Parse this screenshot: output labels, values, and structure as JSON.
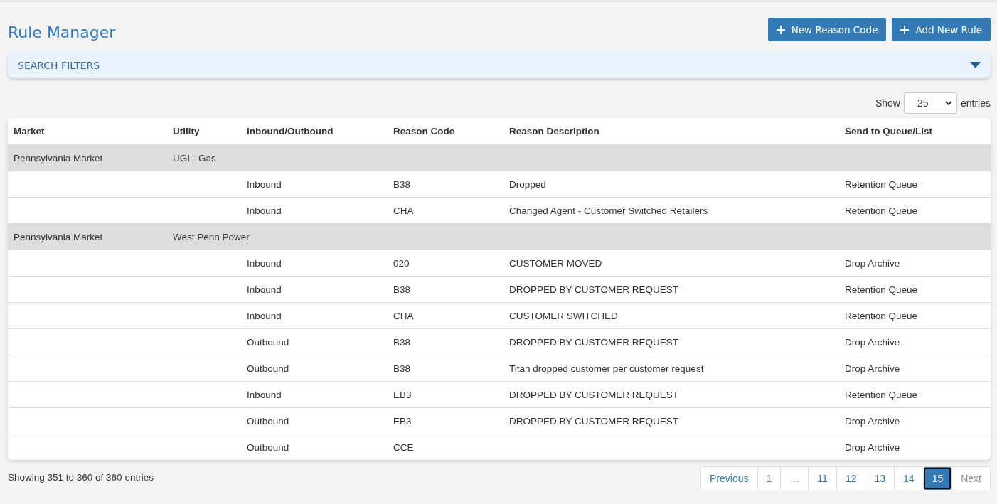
{
  "title": "Rule Manager",
  "actions": [
    "New Reason Code",
    "Add New Rule"
  ],
  "search_filters": {
    "label": "SEARCH FILTERS",
    "expanded": false
  },
  "length": {
    "before": "Show",
    "value": "25",
    "after": "entries"
  },
  "table": {
    "columns": [
      "Market",
      "Utility",
      "Inbound/Outbound",
      "Reason Code",
      "Reason Description",
      "Send to Queue/List"
    ],
    "rows": [
      {
        "kind": "group",
        "cells": [
          "Pennsylvania Market",
          "UGI - Gas"
        ]
      },
      {
        "kind": "rule",
        "cells": [
          "",
          "",
          "Inbound",
          "B38",
          "Dropped",
          "Retention Queue"
        ]
      },
      {
        "kind": "rule",
        "cells": [
          "",
          "",
          "Inbound",
          "CHA",
          "Changed Agent - Customer Switched Retailers",
          "Retention Queue"
        ]
      },
      {
        "kind": "group",
        "cells": [
          "Pennsylvania Market",
          "West Penn Power"
        ]
      },
      {
        "kind": "rule",
        "cells": [
          "",
          "",
          "Inbound",
          "020",
          "CUSTOMER MOVED",
          "Drop Archive"
        ]
      },
      {
        "kind": "rule",
        "cells": [
          "",
          "",
          "Inbound",
          "B38",
          "DROPPED BY CUSTOMER REQUEST",
          "Retention Queue"
        ]
      },
      {
        "kind": "rule",
        "cells": [
          "",
          "",
          "Inbound",
          "CHA",
          "CUSTOMER SWITCHED",
          "Retention Queue"
        ]
      },
      {
        "kind": "rule",
        "cells": [
          "",
          "",
          "Outbound",
          "B38",
          "DROPPED BY CUSTOMER REQUEST",
          "Drop Archive"
        ]
      },
      {
        "kind": "rule",
        "cells": [
          "",
          "",
          "Outbound",
          "B38",
          "Titan dropped customer per customer request",
          "Drop Archive"
        ]
      },
      {
        "kind": "rule",
        "cells": [
          "",
          "",
          "Inbound",
          "EB3",
          "DROPPED BY CUSTOMER REQUEST",
          "Retention Queue"
        ]
      },
      {
        "kind": "rule",
        "cells": [
          "",
          "",
          "Outbound",
          "EB3",
          "DROPPED BY CUSTOMER REQUEST",
          "Drop Archive"
        ]
      },
      {
        "kind": "rule",
        "cells": [
          "",
          "",
          "Outbound",
          "CCE",
          "",
          "Drop Archive"
        ]
      }
    ]
  },
  "info": "Showing 351 to 360 of 360 entries",
  "pagination": [
    {
      "label": "Previous",
      "selected": false,
      "disabled": false
    },
    {
      "label": "1",
      "selected": false,
      "disabled": false
    },
    {
      "label": "…",
      "selected": false,
      "disabled": true
    },
    {
      "label": "11",
      "selected": false,
      "disabled": false
    },
    {
      "label": "12",
      "selected": false,
      "disabled": false
    },
    {
      "label": "13",
      "selected": false,
      "disabled": false
    },
    {
      "label": "14",
      "selected": false,
      "disabled": false
    },
    {
      "label": "15",
      "selected": true,
      "disabled": false
    },
    {
      "label": "Next",
      "selected": false,
      "disabled": true
    }
  ]
}
